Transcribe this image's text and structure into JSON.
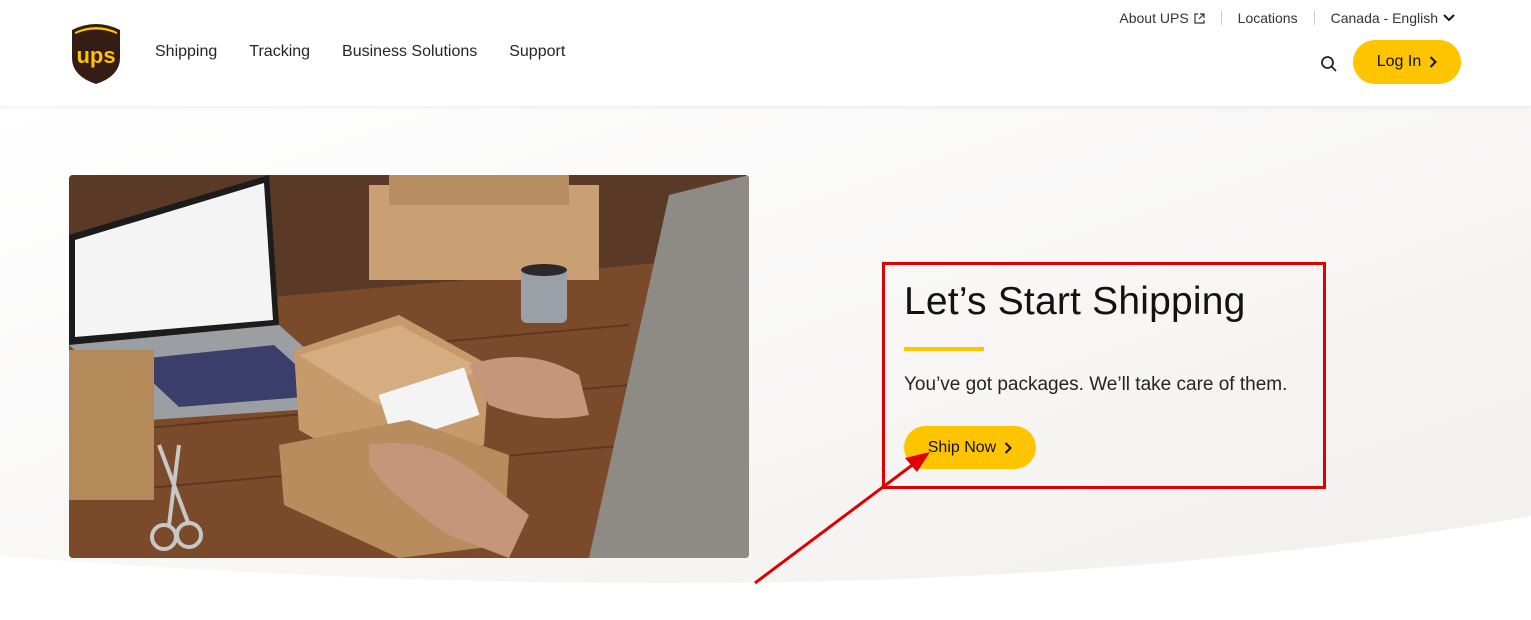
{
  "header": {
    "logo_text": "ups",
    "nav": [
      "Shipping",
      "Tracking",
      "Business Solutions",
      "Support"
    ],
    "utility": {
      "about": "About UPS",
      "locations": "Locations",
      "locale": "Canada - English"
    },
    "search_icon": "search-icon",
    "login_label": "Log In"
  },
  "hero": {
    "title": "Let’s Start Shipping",
    "subtitle": "You’ve got packages. We’ll take care of them.",
    "cta_label": "Ship Now"
  },
  "colors": {
    "brand_brown": "#351c15",
    "brand_yellow": "#ffc400",
    "annotation_red": "#e00000"
  }
}
